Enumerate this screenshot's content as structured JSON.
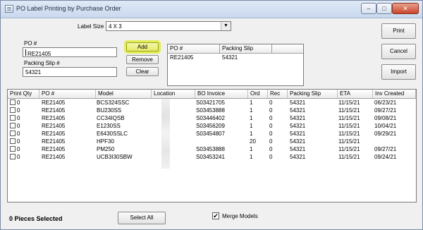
{
  "window": {
    "title": "PO Label Printing by Purchase Order",
    "controls": {
      "minimize": "–",
      "maximize": "□",
      "close": "✕"
    }
  },
  "label_size": {
    "label": "Label Size",
    "value": "4 X 3"
  },
  "po_field": {
    "label": "PO #",
    "value": "RE21405"
  },
  "packing_slip_field": {
    "label": "Packing Slip #",
    "value": "54321"
  },
  "buttons": {
    "add": "Add",
    "remove": "Remove",
    "clear": "Clear",
    "print": "Print",
    "cancel": "Cancel",
    "import": "Import",
    "select_all": "Select All"
  },
  "mini_table": {
    "headers": [
      "PO #",
      "Packing Slip"
    ],
    "rows": [
      [
        "RE21405",
        "54321"
      ]
    ]
  },
  "grid": {
    "headers": [
      "Print Qty",
      "PO #",
      "Model",
      "Location",
      "BO Invoice",
      "Ord",
      "Rec",
      "Packing Slip",
      "ETA",
      "Inv Created"
    ],
    "rows": [
      [
        "0",
        "RE21405",
        "BCS324SSC",
        "",
        "S03421705",
        "1",
        "0",
        "54321",
        "11/15/21",
        "06/23/21"
      ],
      [
        "0",
        "RE21405",
        "BU230SS",
        "",
        "S03453888",
        "1",
        "0",
        "54321",
        "11/15/21",
        "09/27/21"
      ],
      [
        "0",
        "RE21405",
        "CC34IQSB",
        "",
        "S03446402",
        "1",
        "0",
        "54321",
        "11/15/21",
        "09/08/21"
      ],
      [
        "0",
        "RE21405",
        "E1230SS",
        "",
        "S03456209",
        "1",
        "0",
        "54321",
        "11/15/21",
        "10/04/21"
      ],
      [
        "0",
        "RE21405",
        "E6430SSLC",
        "",
        "S03454807",
        "1",
        "0",
        "54321",
        "11/15/21",
        "09/29/21"
      ],
      [
        "0",
        "RE21405",
        "HPF30",
        "",
        "",
        "20",
        "0",
        "54321",
        "11/15/21",
        ""
      ],
      [
        "0",
        "RE21405",
        "PM250",
        "",
        "S03453888",
        "1",
        "0",
        "54321",
        "11/15/21",
        "09/27/21"
      ],
      [
        "0",
        "RE21405",
        "UCB3I30SBW",
        "",
        "S03453241",
        "1",
        "0",
        "54321",
        "11/15/21",
        "09/24/21"
      ]
    ]
  },
  "status": {
    "pieces_selected": "0 Pieces Selected"
  },
  "merge_models": {
    "label": "Merge Models",
    "checked": true,
    "mark": "✔"
  }
}
